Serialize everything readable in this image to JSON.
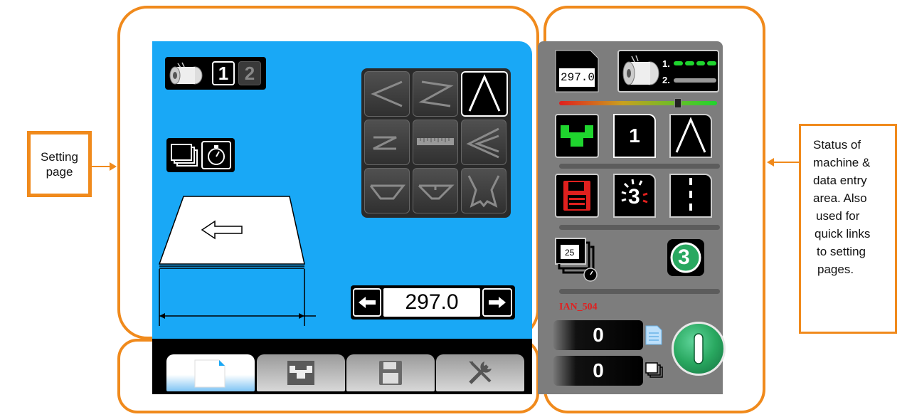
{
  "callouts": {
    "left_line1": "Setting",
    "left_line2": "page",
    "right_lines": [
      "Status of",
      "machine &",
      "data entry",
      "area. Also",
      "used for",
      "quick links",
      "to setting",
      "pages."
    ]
  },
  "setting_page": {
    "roll_selector": {
      "option1": "1",
      "option2": "2",
      "selected": "1"
    },
    "length_value": "297.0",
    "tabs": [
      {
        "icon": "page-icon",
        "active": true
      },
      {
        "icon": "tray-icon",
        "active": false
      },
      {
        "icon": "floppy-disk-icon",
        "active": false
      },
      {
        "icon": "tools-icon",
        "active": false
      }
    ],
    "fold_grid": [
      "fold-type-v-left-icon",
      "fold-type-z-icon",
      "fold-type-lambda-icon",
      "fold-type-z-small-icon",
      "ruler-icon",
      "fold-type-double-v-icon",
      "fold-type-trapezoid-icon",
      "fold-type-trapezoid-alt-icon",
      "fold-type-special-icon"
    ]
  },
  "status_panel": {
    "document_length": "297.0",
    "roll_labels": [
      "1.",
      "2."
    ],
    "program_number": "1",
    "countdown": "3",
    "timer_value": "25",
    "badge_number": "3",
    "job_name": "IAN_504",
    "counter_pages": "0",
    "counter_sets": "0",
    "colors": {
      "accent_green": "#1fd52e",
      "alert_red": "#e0201e",
      "job_name_red": "#e02020"
    }
  }
}
